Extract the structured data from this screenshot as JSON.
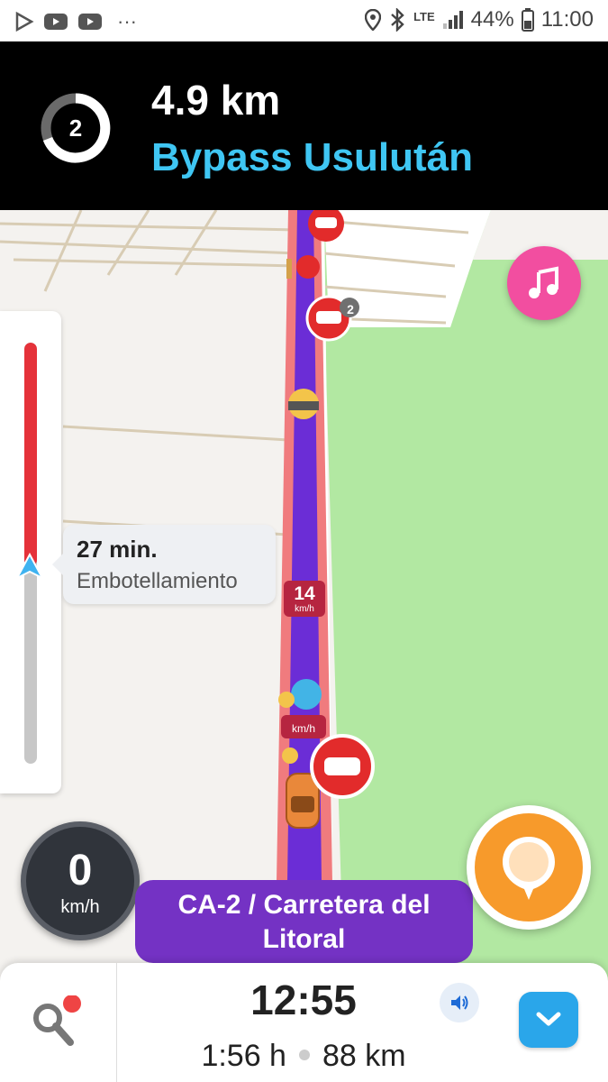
{
  "status_bar": {
    "network": "LTE",
    "battery": "44%",
    "time": "11:00"
  },
  "instruction": {
    "exit_number": "2",
    "distance": "4.9 km",
    "street": "Bypass Usulután"
  },
  "progress": {
    "remaining_fraction": 0.53
  },
  "eta_bubble": {
    "minutes": "27 min.",
    "label": "Embotellamiento"
  },
  "speed_limit_signs": [
    {
      "value": "14",
      "unit": "km/h"
    },
    {
      "value": "",
      "unit": "km/h"
    }
  ],
  "speedometer": {
    "value": "0",
    "unit": "km/h"
  },
  "current_street": "CA-2 / Carretera del Litoral",
  "alert_badge_count": "2",
  "bottom_bar": {
    "arrival_time": "12:55",
    "duration": "1:56 h",
    "distance": "88 km"
  },
  "colors": {
    "route": "#6b2dd6",
    "traffic": "#e5323a",
    "accent_blue": "#3fc6f3",
    "music": "#f24ea0",
    "report": "#f79a2b"
  }
}
